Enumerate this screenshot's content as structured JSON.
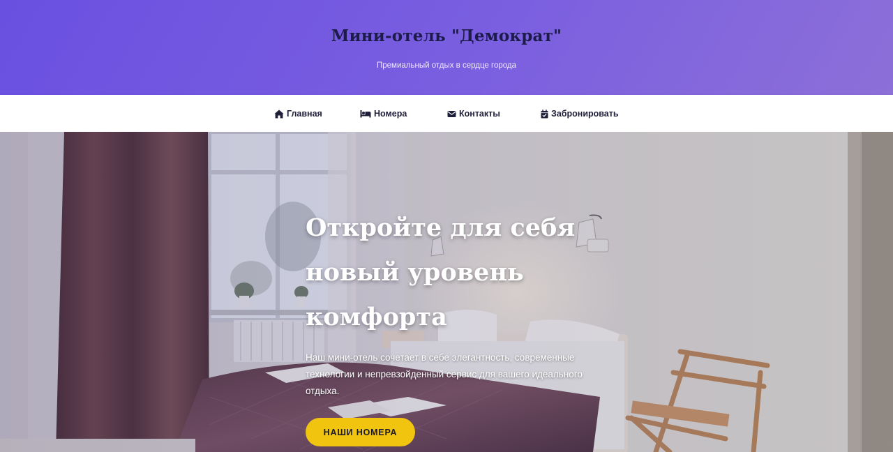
{
  "header": {
    "title": "Мини-отель \"Демократ\"",
    "tagline": "Премиальный отдых в сердце города"
  },
  "nav": {
    "items": [
      {
        "label": "Главная",
        "icon": "home-icon"
      },
      {
        "label": "Номера",
        "icon": "bed-icon"
      },
      {
        "label": "Контакты",
        "icon": "envelope-icon"
      },
      {
        "label": "Забронировать",
        "icon": "calendar-check-icon"
      }
    ]
  },
  "hero": {
    "title": "Откройте для себя новый уровень комфорта",
    "description": "Наш мини-отель сочетает в себе элегантность, современные технологии и непревзойденный сервис для вашего идеального отдыха.",
    "button_label": "НАШИ НОМЕРА"
  },
  "colors": {
    "header_gradient_start": "#6a50e0",
    "header_gradient_end": "#8d6fd8",
    "title_color": "#1c1b4a",
    "accent_button": "#f1c40f"
  }
}
